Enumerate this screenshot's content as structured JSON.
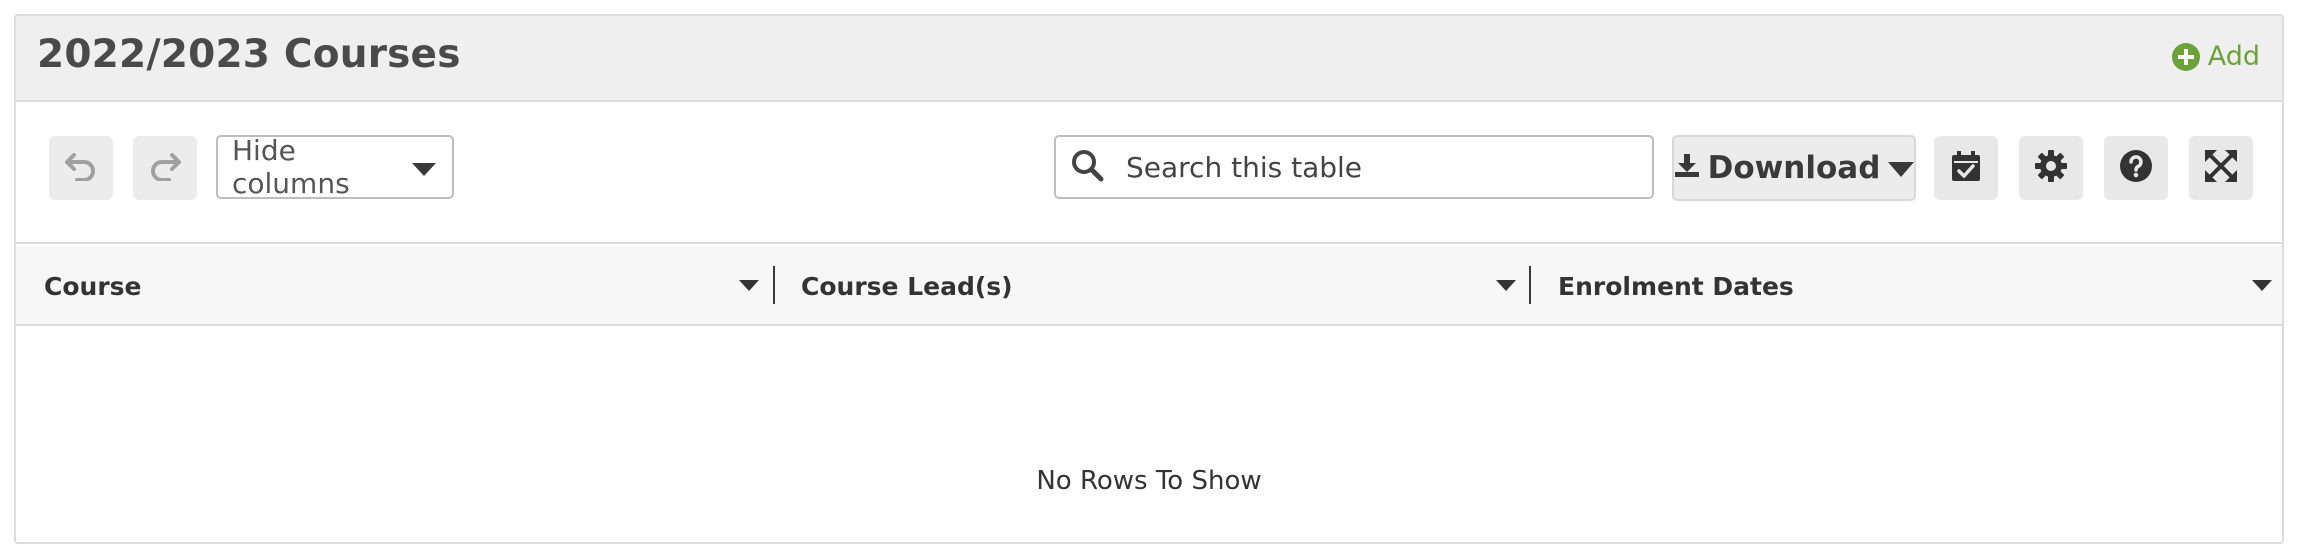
{
  "panel": {
    "title": "2022/2023 Courses",
    "add_label": "Add"
  },
  "toolbar": {
    "undo_icon": "undo-icon",
    "redo_icon": "redo-icon",
    "hide_columns_label": "Hide columns",
    "search_placeholder": "Search this table",
    "download_label": "Download",
    "buttons": [
      "calendar-check-icon",
      "gear-icon",
      "question-circle-icon",
      "expand-icon"
    ]
  },
  "grid": {
    "columns": [
      {
        "label": "Course"
      },
      {
        "label": "Course Lead(s)"
      },
      {
        "label": "Enrolment Dates"
      }
    ],
    "empty_message": "No Rows To Show"
  },
  "colors": {
    "accent": "#6ba33a",
    "header_bg": "#efefef",
    "border": "#dcdcdc"
  }
}
